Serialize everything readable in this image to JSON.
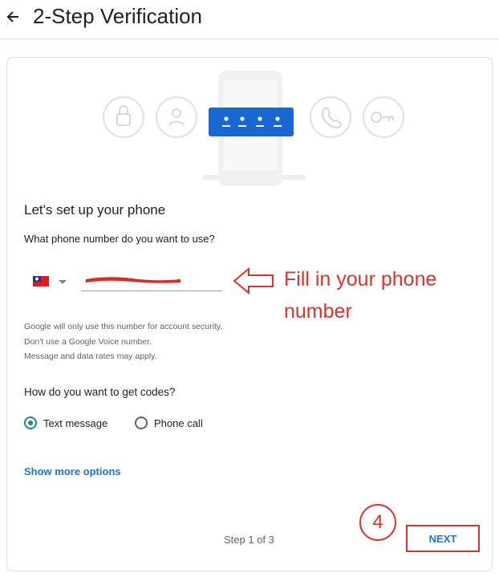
{
  "header": {
    "back_icon": "arrow-back-icon",
    "title": "2-Step Verification"
  },
  "illustration": {
    "icons": [
      "lock-icon",
      "account-circle-icon",
      "password-dots-icon",
      "phone-icon",
      "key-icon"
    ],
    "accent": "#1967d2"
  },
  "setup": {
    "heading": "Let's set up your phone",
    "question": "What phone number do you want to use?",
    "country_flag": "taiwan-flag-icon",
    "phone_value_note": "redacted",
    "help_lines": [
      "Google will only use this number for account security.",
      "Don't use a Google Voice number.",
      "Message and data rates may apply."
    ]
  },
  "codes": {
    "question": "How do you want to get codes?",
    "options": [
      {
        "label": "Text message",
        "selected": true
      },
      {
        "label": "Phone call",
        "selected": false
      }
    ]
  },
  "more_options": "Show more options",
  "footer": {
    "step": "Step 1 of 3",
    "next": "NEXT"
  },
  "annotations": {
    "instruction_lines": [
      "Fill in your phone",
      "number"
    ],
    "step_number": "4",
    "color": "#e0312d"
  },
  "colors": {
    "link": "#1a73e8",
    "radio": "#1a8c85",
    "border": "#dadce0"
  }
}
